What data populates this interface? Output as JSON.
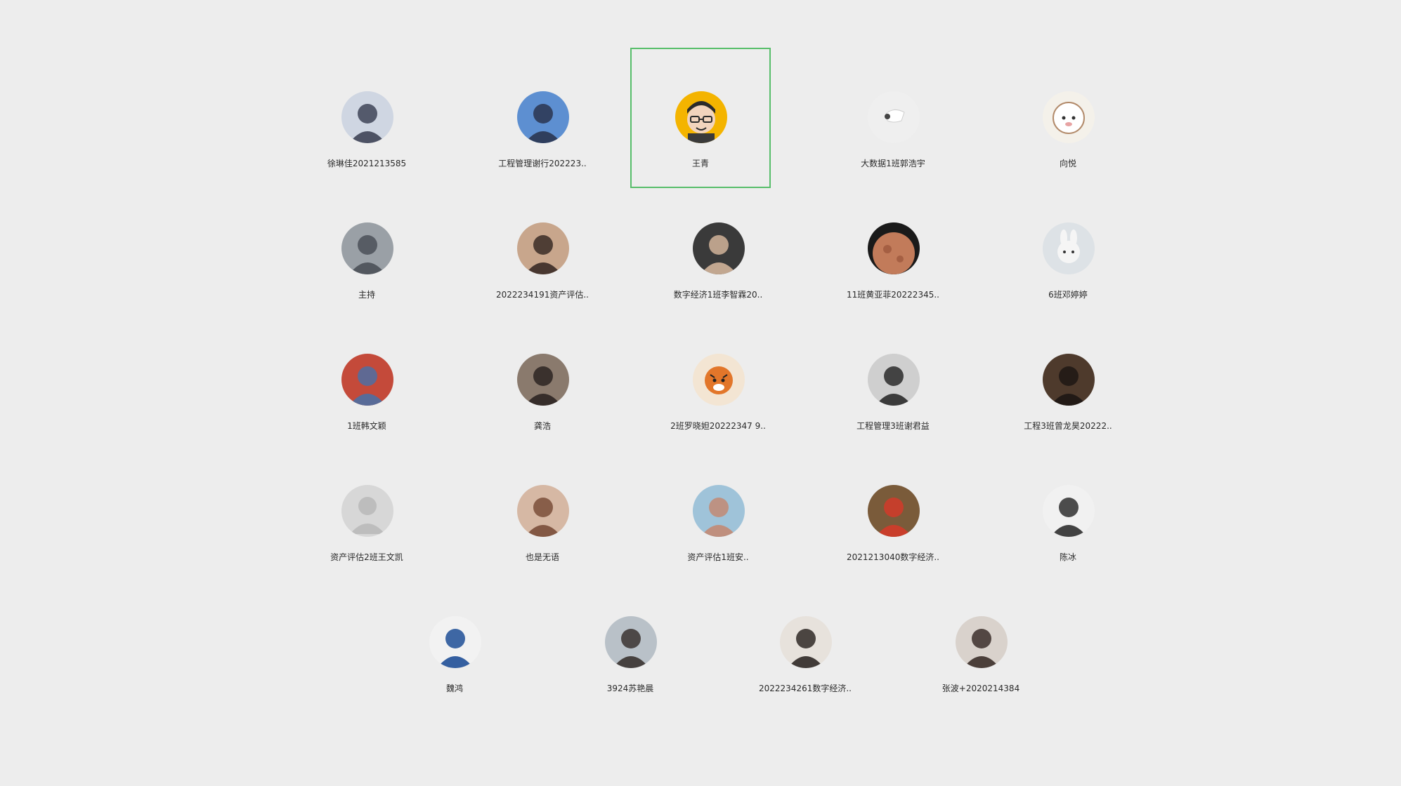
{
  "selected_index": 2,
  "members": [
    {
      "name": "徐琳佳2021213585",
      "avatar_icon": "anime-dark-hair-avatar",
      "bg": "#cfd6e2",
      "fg": "#3e4457"
    },
    {
      "name": "工程管理谢行202223..",
      "avatar_icon": "snowy-mountain-photo-avatar",
      "bg": "#5d8fd1",
      "fg": "#2a3550"
    },
    {
      "name": "王青",
      "avatar_icon": "cartoon-glasses-avatar",
      "bg": "#f4b400",
      "fg": "#2b2b2b"
    },
    {
      "name": "大数据1班郭浩宇",
      "avatar_icon": "white-object-avatar",
      "bg": "#efefef",
      "fg": "#444444"
    },
    {
      "name": "向悦",
      "avatar_icon": "cartoon-sheep-avatar",
      "bg": "#f4f1ea",
      "fg": "#b28a6a"
    },
    {
      "name": "主持",
      "avatar_icon": "grey-portrait-avatar",
      "bg": "#9aa0a6",
      "fg": "#4b5058"
    },
    {
      "name": "2022234191资产评估..",
      "avatar_icon": "girl-portrait-avatar",
      "bg": "#c8a68c",
      "fg": "#3a2b26"
    },
    {
      "name": "数字经济1班李智霖20..",
      "avatar_icon": "dark-man-portrait-avatar",
      "bg": "#3a3a3a",
      "fg": "#d2b49a"
    },
    {
      "name": "11班黄亚菲20222345..",
      "avatar_icon": "planet-avatar",
      "bg": "#1a1a1a",
      "fg": "#c27b5a"
    },
    {
      "name": "6班邓婷婷",
      "avatar_icon": "cartoon-rabbit-avatar",
      "bg": "#dde2e6",
      "fg": "#f5f5f5"
    },
    {
      "name": "1班韩文颖",
      "avatar_icon": "cartoon-couple-avatar",
      "bg": "#c44a3a",
      "fg": "#4d6fa3"
    },
    {
      "name": "龚浩",
      "avatar_icon": "hair-closeup-avatar",
      "bg": "#8a7a6d",
      "fg": "#2c2522"
    },
    {
      "name": "2班罗晓妲20222347 9..",
      "avatar_icon": "cartoon-tiger-avatar",
      "bg": "#f3e5d3",
      "fg": "#e2762a"
    },
    {
      "name": "工程管理3班谢君益",
      "avatar_icon": "bw-man-portrait-avatar",
      "bg": "#cfcfcf",
      "fg": "#2a2a2a"
    },
    {
      "name": "工程3班曾龙昊20222..",
      "avatar_icon": "dark-portrait-avatar",
      "bg": "#4e3a2c",
      "fg": "#1e1714"
    },
    {
      "name": "资产评估2班王文凯",
      "avatar_icon": "default-person-avatar",
      "bg": "#d7d7d7",
      "fg": "#bdbdbd"
    },
    {
      "name": "也是无语",
      "avatar_icon": "face-closeup-avatar",
      "bg": "#d6b8a4",
      "fg": "#7a4e3a"
    },
    {
      "name": "资产评估1班安..",
      "avatar_icon": "man-in-water-avatar",
      "bg": "#9fc3d9",
      "fg": "#c28a73"
    },
    {
      "name": "2021213040数字经济..",
      "avatar_icon": "cartoon-characters-avatar",
      "bg": "#7a5b3a",
      "fg": "#d23b2a"
    },
    {
      "name": "陈冰",
      "avatar_icon": "woman-portrait-avatar",
      "bg": "#f1f1f1",
      "fg": "#2f2f2f"
    },
    {
      "name": "魏鸿",
      "avatar_icon": "man-blue-shirt-avatar",
      "bg": "#f2f2f2",
      "fg": "#1f4f97"
    },
    {
      "name": "3924苏艳晨",
      "avatar_icon": "young-man-portrait-avatar",
      "bg": "#b9c1c8",
      "fg": "#3a3330"
    },
    {
      "name": "2022234261数字经济..",
      "avatar_icon": "dog-photo-avatar",
      "bg": "#e7e2dc",
      "fg": "#2f2926"
    },
    {
      "name": "张波+2020214384",
      "avatar_icon": "couple-photo-avatar",
      "bg": "#d9d2cc",
      "fg": "#3b2f2a"
    }
  ]
}
